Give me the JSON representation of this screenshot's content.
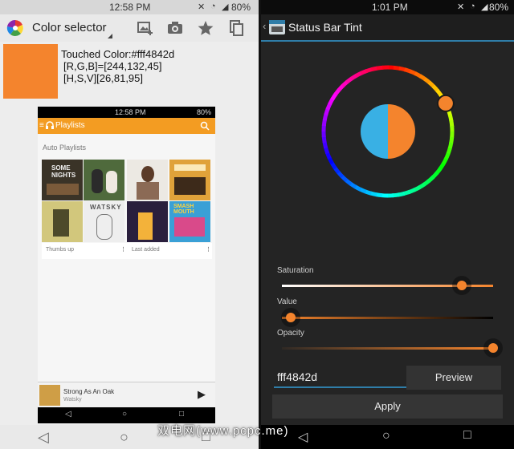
{
  "left": {
    "status": {
      "time": "12:58 PM",
      "battery": "80%"
    },
    "app": {
      "title": "Color selector"
    },
    "touched": {
      "color_line": "Touched Color:#fff4842d",
      "rgb_line": "[R,G,B]=[244,132,45]",
      "hsv_line": "[H,S,V][26,81,95]"
    },
    "colors": {
      "swatch": "#f4842d",
      "accent": "#f39c22"
    },
    "phone": {
      "status_time": "12:58 PM",
      "status_battery": "80%",
      "title": "Playlists",
      "section": "Auto Playlists",
      "cards": [
        {
          "label": "Thumbs up"
        },
        {
          "label": "Last added"
        }
      ],
      "albums": [
        "SOME NIGHTS",
        "",
        "",
        "",
        "",
        "WATSKY",
        "",
        "SMASH MOUTH"
      ],
      "player": {
        "song": "Strong As An Oak",
        "artist": "Watsky"
      }
    }
  },
  "right": {
    "status": {
      "time": "1:01 PM",
      "battery": "80%"
    },
    "app": {
      "title": "Status Bar Tint"
    },
    "saturation": {
      "label": "Saturation",
      "value": 0.85
    },
    "value_slider": {
      "label": "Value",
      "value": 0.04
    },
    "opacity": {
      "label": "Opacity",
      "value": 1.0
    },
    "hex": {
      "value": "fff4842d"
    },
    "preview": {
      "label": "Preview"
    },
    "apply": {
      "label": "Apply"
    },
    "colors": {
      "selected": "#f4842d",
      "preview_left": "#39b0e4",
      "accent": "#2f7da8"
    }
  },
  "watermark": "双电网(www.pcpc.me)"
}
